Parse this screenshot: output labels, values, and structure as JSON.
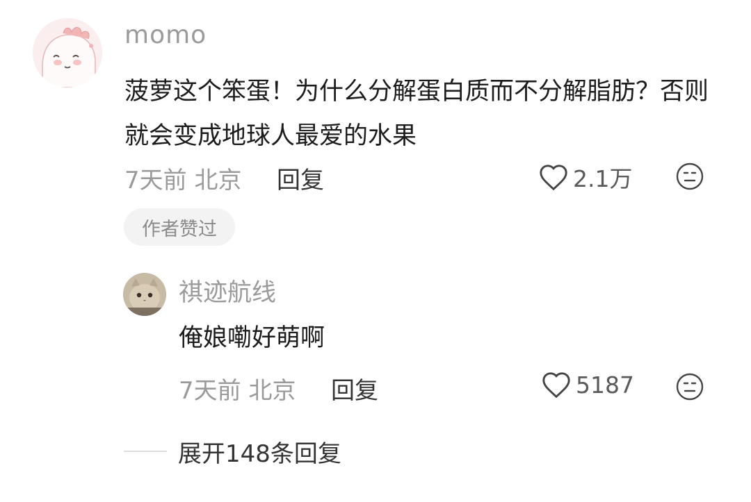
{
  "comment": {
    "username": "momo",
    "text": "菠萝这个笨蛋！为什么分解蛋白质而不分解脂肪？否则就会变成地球人最爱的水果",
    "time_location": "7天前 北京",
    "reply_label": "回复",
    "likes": "2.1万",
    "author_badge": "作者赞过"
  },
  "reply": {
    "username": "祺迹航线",
    "text": "俺娘嘞好萌啊",
    "time_location": "7天前 北京",
    "reply_label": "回复",
    "likes": "5187"
  },
  "expand": {
    "label": "展开148条回复"
  },
  "icons": {
    "like": "heart-outline-icon",
    "dislike": "meh-face-icon"
  },
  "colors": {
    "secondary_text": "#9a9a9a",
    "primary_text": "#1c1c1c",
    "badge_bg": "#f3f3f3"
  }
}
